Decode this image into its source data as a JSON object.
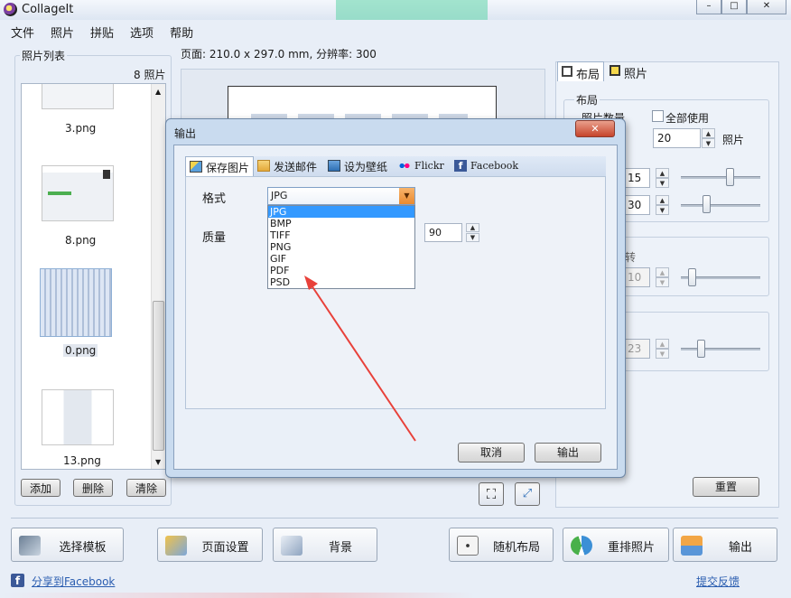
{
  "app": {
    "title": "CollageIt"
  },
  "window_controls": {
    "minimize": "–",
    "maximize": "□",
    "close": "✕"
  },
  "menu": [
    "文件",
    "照片",
    "拼贴",
    "选项",
    "帮助"
  ],
  "photo_list": {
    "title": "照片列表",
    "count": "8 照片",
    "items": [
      "3.png",
      "8.png",
      "0.png",
      "13.png"
    ],
    "buttons": {
      "add": "添加",
      "delete": "删除",
      "clear": "清除"
    }
  },
  "page_info": "页面: 210.0 x 297.0 mm, 分辨率: 300",
  "right_panel": {
    "tabs": [
      "布局",
      "照片"
    ],
    "layout_group": "布局",
    "photo_count_label": "照片数量",
    "use_all": "全部使用",
    "photo_count_value": "20",
    "photo_unit": "照片",
    "value_a": "15",
    "value_b": "30",
    "rotate_partial": "转",
    "value_c": "10",
    "value_d": "23",
    "reset": "重置"
  },
  "bottom_buttons": [
    "选择模板",
    "页面设置",
    "背景",
    "随机布局",
    "重排照片",
    "输出"
  ],
  "footer": {
    "share": "分享到Facebook",
    "feedback": "提交反馈"
  },
  "dialog": {
    "title": "输出",
    "close": "✕",
    "tabs": [
      "保存图片",
      "发送邮件",
      "设为壁纸",
      "Flickr",
      "Facebook"
    ],
    "format_label": "格式",
    "quality_label": "质量",
    "format_selected": "JPG",
    "format_options": [
      "JPG",
      "BMP",
      "TIFF",
      "PNG",
      "GIF",
      "PDF",
      "PSD"
    ],
    "quality_value": "90",
    "cancel": "取消",
    "output": "输出"
  },
  "colors": {
    "accent": "#3399ff",
    "annotation_arrow": "#e8413a",
    "dropdown_arrow": "#ea8a2f"
  }
}
